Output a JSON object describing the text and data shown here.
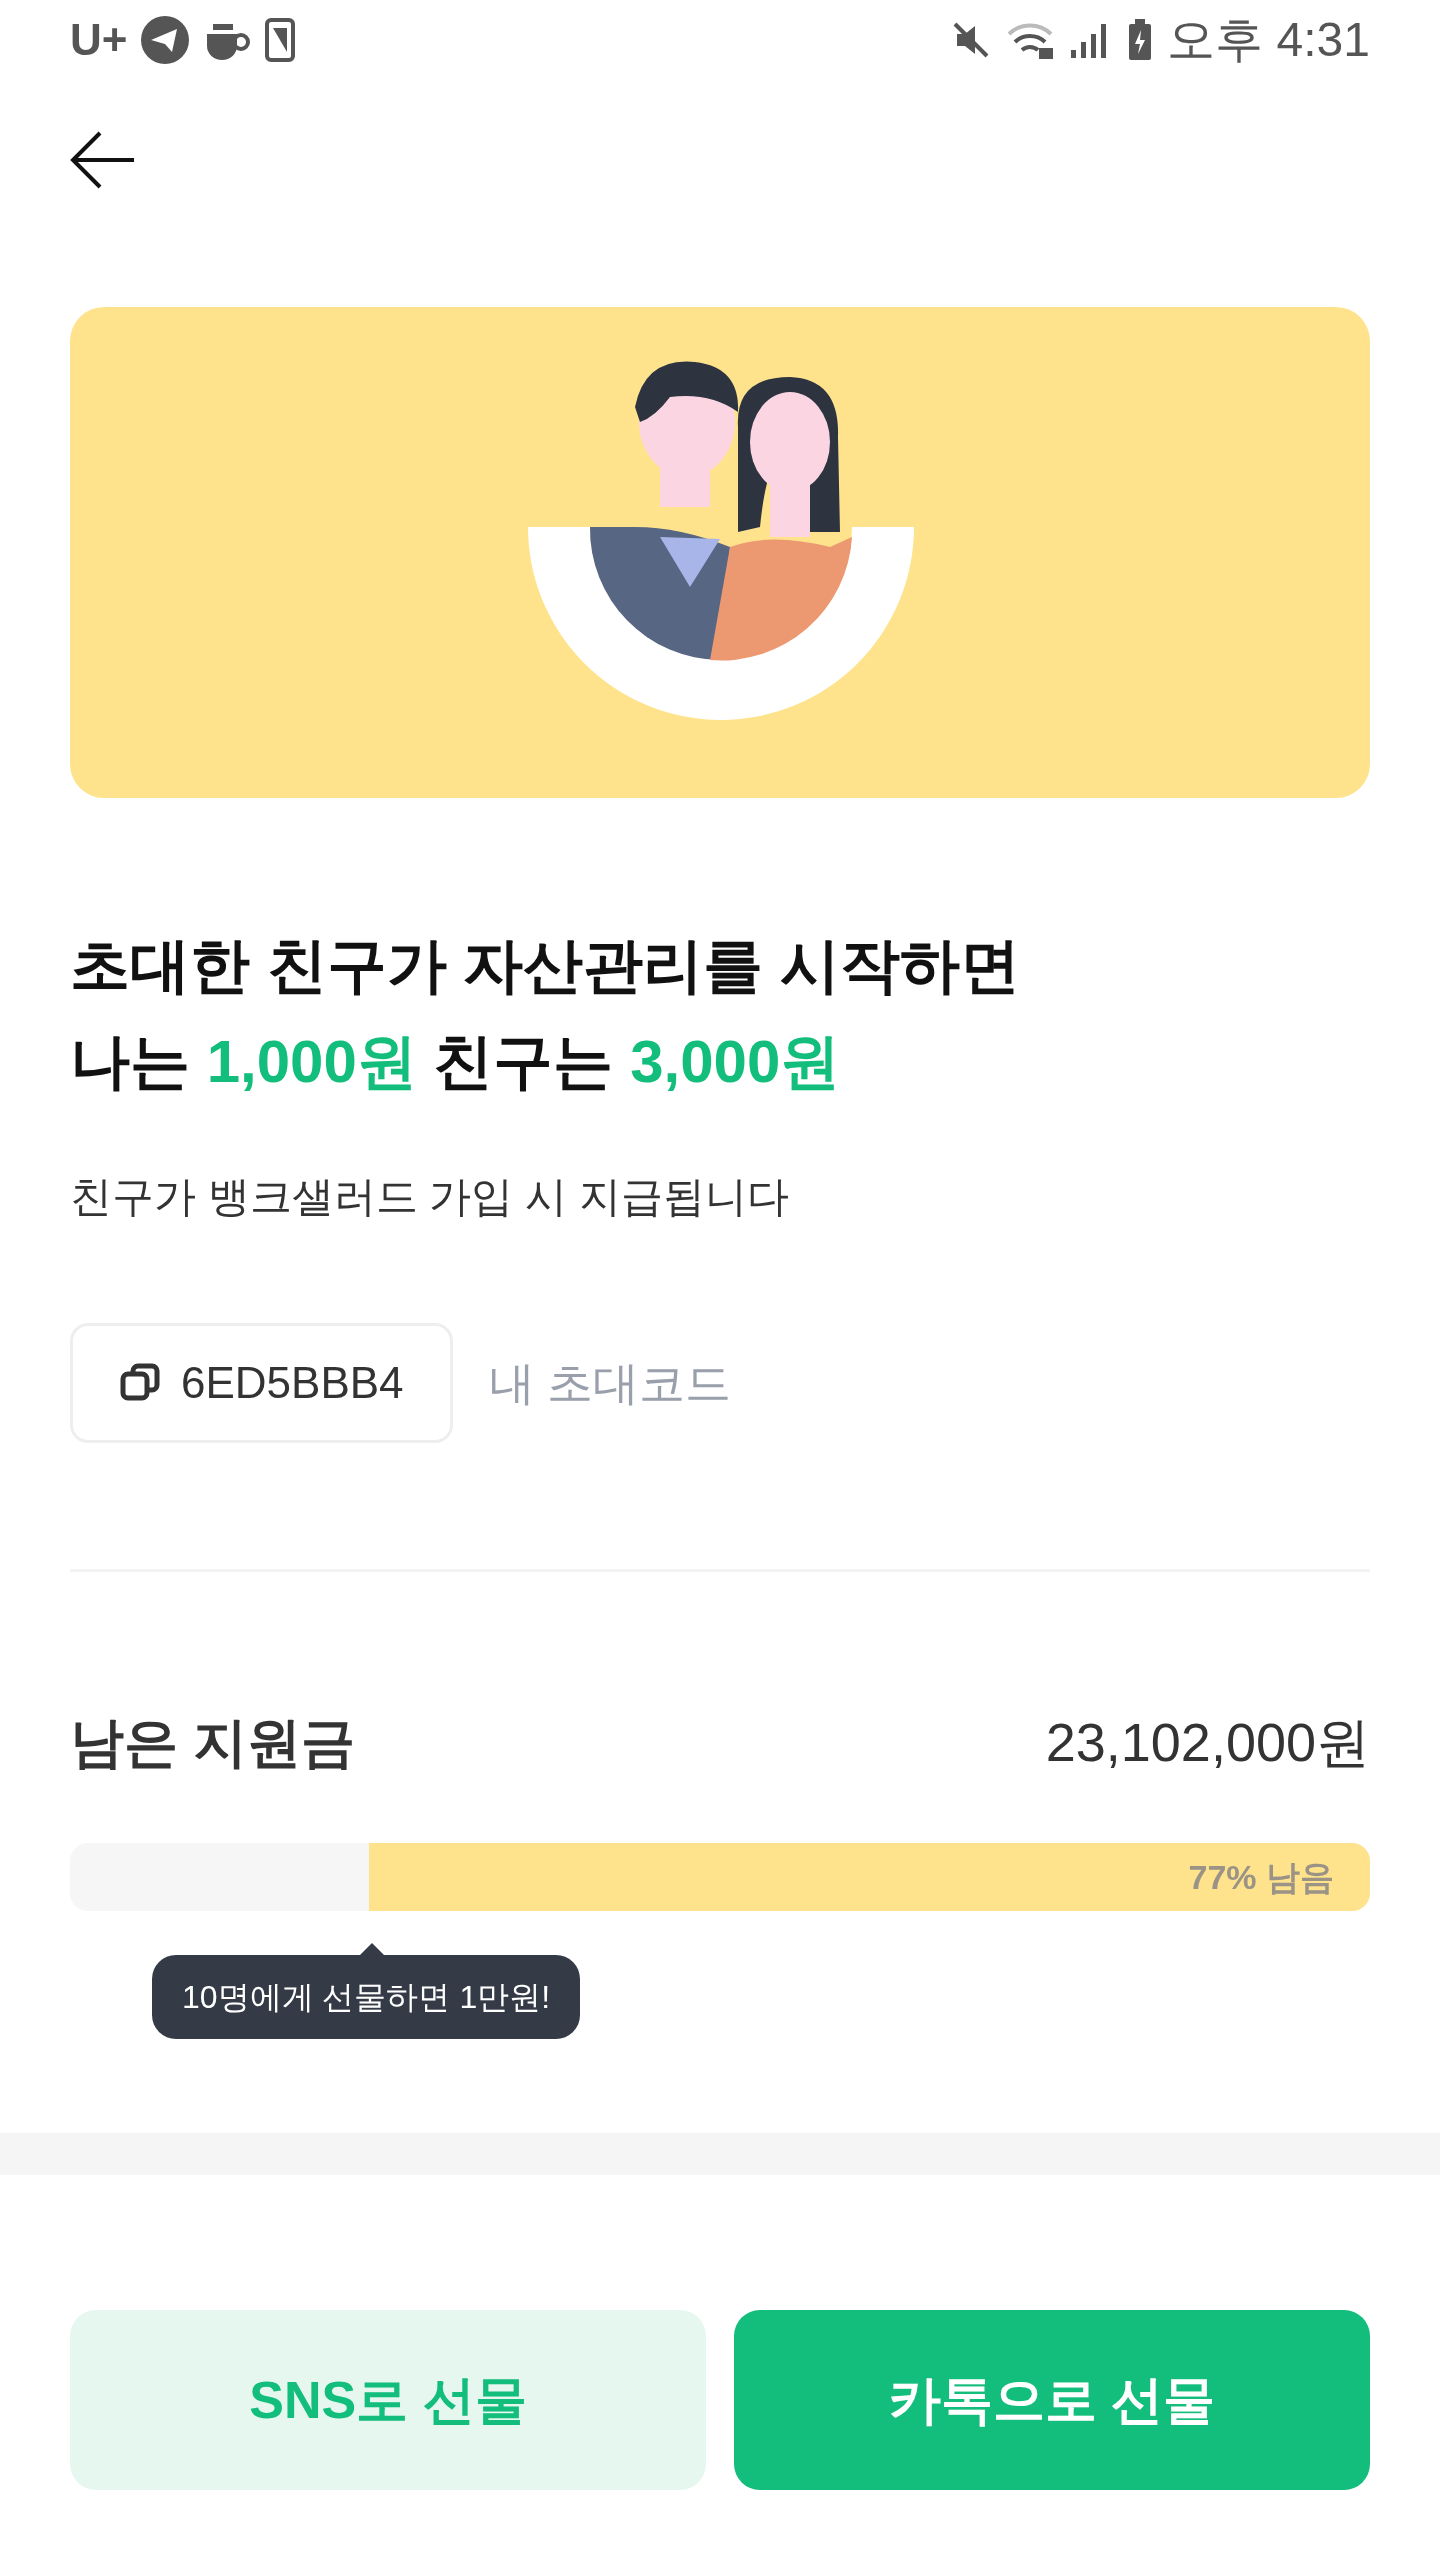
{
  "status_bar": {
    "carrier": "U+",
    "time": "오후 4:31"
  },
  "headline": {
    "line1": "초대한 친구가 자산관리를 시작하면",
    "line2": "나는 **1,000원** 친구는 **3,000원**"
  },
  "subtitle": "친구가 뱅크샐러드 가입 시 지급됩니다",
  "invite_code": {
    "code": "6ED5BBB4",
    "label": "내 초대코드"
  },
  "fund": {
    "title": "남은 지원금",
    "amount": "23,102,000원",
    "level": 0.77,
    "reading": "77% 남음",
    "tooltip": "10명에게 선물하면 1만원!"
  },
  "buttons": [
    {
      "label": "SNS로 선물",
      "kind": "secondary"
    },
    {
      "label": "카톡으로 선물",
      "kind": "primary"
    }
  ]
}
